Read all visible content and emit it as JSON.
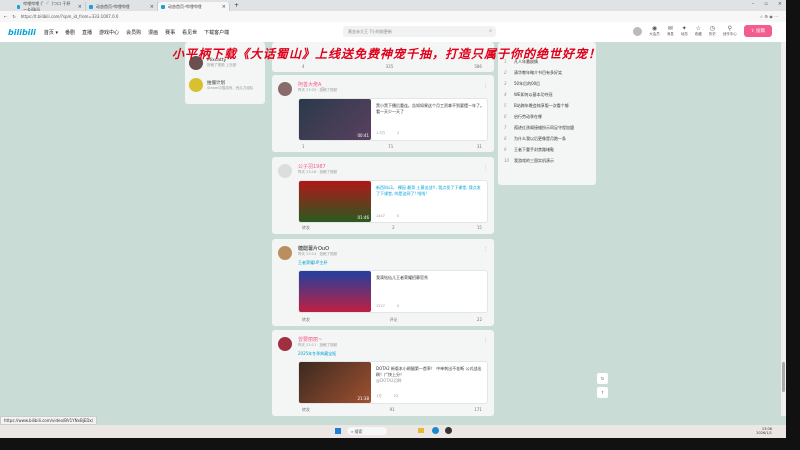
{
  "browser": {
    "tabs": [
      "哔哩哔哩 (゜-゜)つロ 干杯~-bilibili",
      "动态首页-哔哩哔哩",
      "动态首页-哔哩哔哩"
    ],
    "url": "https://t.bilibili.com/?spm_id_from=333.1007.0.0",
    "status_url": "https://www.bilibili.com/video/BV1YNxBjEDx/"
  },
  "header": {
    "logo": "bilibili",
    "nav": [
      "首页 ▾",
      "番剧",
      "直播",
      "游戏中心",
      "会员购",
      "漫画",
      "赛事",
      "看见世",
      "下载客户端"
    ],
    "search_placeholder": "黄金赤大王 7小时前更新",
    "icons": [
      {
        "label": "大会员",
        "glyph": "◉"
      },
      {
        "label": "消息",
        "glyph": "✉"
      },
      {
        "label": "动态",
        "glyph": "✦"
      },
      {
        "label": "收藏",
        "glyph": "☆"
      },
      {
        "label": "历史",
        "glyph": "◷"
      },
      {
        "label": "创作中心",
        "glyph": "⚲"
      }
    ],
    "upload": "⇪ 投稿"
  },
  "overlay_text": "小平柄下载《大话蜀山》上线送免费神宠千抽，打造只属于你的绝世好宠！",
  "left_card": {
    "items": [
      {
        "name": "Mixcatty",
        "sub": "投稿了视频 上社团·"
      },
      {
        "name": "拍僵计划",
        "sub": "Steam中国游戏，西瓜刀组队"
      }
    ]
  },
  "trending": {
    "items": [
      {
        "rank": "1",
        "title": "凡人年番剧情"
      },
      {
        "rank": "2",
        "title": "清华教年略介书目有多好笑"
      },
      {
        "rank": "3",
        "title": "50年后的00后"
      },
      {
        "rank": "4",
        "title": "WE如何以基本功夺冠"
      },
      {
        "rank": "5",
        "title": "B站跨年晚会纯享版一次看个够"
      },
      {
        "rank": "6",
        "title": "启行劳动季在哪"
      },
      {
        "rank": "7",
        "title": "孤迹红孩阁接蜡扮示同足守程加盟"
      },
      {
        "rank": "8",
        "title": "为什么我以后更像是月跑一条"
      },
      {
        "rank": "9",
        "title": "王者下重手封禁路堵鞋"
      },
      {
        "rank": "10",
        "title": "我游戏的三国实机演示"
      }
    ]
  },
  "posts": [
    {
      "footer": [
        "4",
        "335",
        "586"
      ]
    },
    {
      "author": "阿善大佬A_",
      "time": "昨天 23:25 · 投稿了视频",
      "text": "黑小黑下播后重连。告知如果这个月工资拿不到要摆一年了。看一天少一天了",
      "duration": "00:41",
      "stats": [
        "1.5万",
        "2"
      ],
      "footer": [
        "1",
        "71",
        "31"
      ]
    },
    {
      "author": "公子羽1987",
      "time": "昨天 23:16 · 投稿了视频",
      "text": "新西科s3。 裸因 最哥 土黄出战!!, 我点发了下课堂, 我点发了下课堂, 的是这网了! 啦啦!",
      "duration": "01:46",
      "stats": [
        "1447",
        "0"
      ],
      "footer": [
        "转发",
        "2",
        "15"
      ]
    },
    {
      "author": "糖醋薯片OuO",
      "time": "昨天 23:14 · 投稿了视频",
      "topic": "王者荣耀UP主杯",
      "text": "我滴钻仙儿王者荣耀招募官秀",
      "stats": [
        "1227",
        "0"
      ],
      "footer": [
        "转发",
        "评论",
        "22"
      ]
    },
    {
      "author": "曾要丽丽~",
      "time": "昨天 23:11 · 投稿了视频",
      "topic": "2025年冬季典藏宝瓶",
      "text": "DOTA2 新版本小刷腿第一首率！ 中单刺出不花断 公式战出刷！广快上分！",
      "at": "@DOTA2回眸",
      "duration": "21:38",
      "stats": [
        "1万",
        "23"
      ],
      "footer": [
        "转发",
        "91",
        "171"
      ]
    }
  ],
  "taskbar": {
    "search": "搜索",
    "time": "13:06",
    "date": "2026/1/1"
  }
}
